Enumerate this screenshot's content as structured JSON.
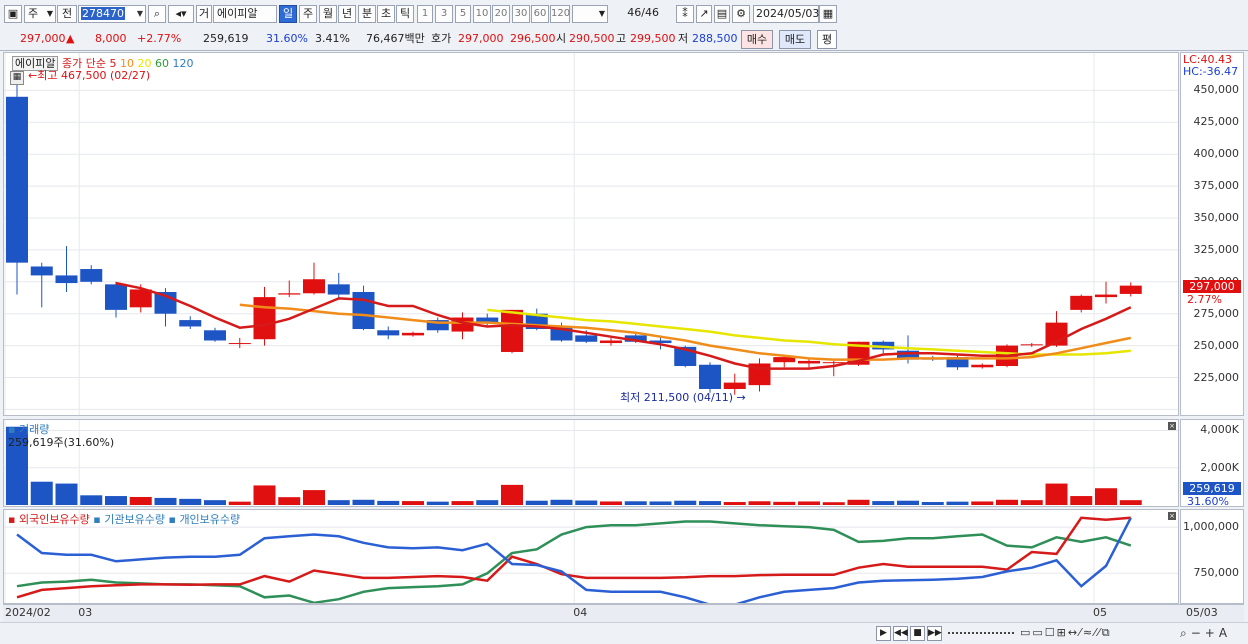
{
  "toolbar": {
    "market": "주",
    "period_ref": "전",
    "code": "278470",
    "trade_label": "거",
    "stock_name": "에이피알",
    "periods": [
      "일",
      "주",
      "월",
      "년",
      "분",
      "초",
      "틱"
    ],
    "selected_period": "일",
    "intervals": [
      "1",
      "3",
      "5",
      "10",
      "20",
      "30",
      "60",
      "120"
    ],
    "count": "46/46",
    "date": "2024/05/03"
  },
  "pricebar": {
    "price": "297,000",
    "direction": "▲",
    "change": "8,000",
    "change_pct": "+2.77%",
    "volume": "259,619",
    "turnover": "31.60%",
    "ratio": "3.41%",
    "amount": "76,467백만",
    "quote_label": "호가",
    "ask": "297,000",
    "bid": "296,500",
    "open_label": "시",
    "open": "290,500",
    "high_label": "고",
    "high": "299,500",
    "low_label": "저",
    "low": "288,500",
    "buy_label": "매수",
    "sell_label": "매도",
    "avg_label": "평"
  },
  "chart_legend": {
    "name": "에이피알",
    "ma_label": "종가 단순",
    "ma_periods": [
      "5",
      "10",
      "20",
      "60",
      "120"
    ],
    "ma_colors": [
      "#d61a1a",
      "#f08c1a",
      "#e6e600",
      "#2f9a3c",
      "#2e7dbd"
    ],
    "high_note": "최고 467,500 (02/27)",
    "low_note": "최저 211,500 (04/11)",
    "lc": "LC:40.43",
    "hc": "HC:-36.47",
    "current_price": "297,000",
    "current_pct": "2.77%"
  },
  "volume_legend": {
    "title": "거래량",
    "current": "259,619주(31.60%)",
    "axis_current": "259,619",
    "axis_pct": "31.60%"
  },
  "holdings_legend": {
    "foreign": "외국인보유수량",
    "institution": "기관보유수량",
    "individual": "개인보유수량"
  },
  "price_axis": [
    "450,000",
    "425,000",
    "400,000",
    "375,000",
    "350,000",
    "325,000",
    "300,000",
    "275,000",
    "250,000",
    "225,000"
  ],
  "volume_axis": [
    "4,000K",
    "2,000K"
  ],
  "holdings_axis": [
    "1,000,000",
    "750,000"
  ],
  "date_axis": [
    {
      "label": "2024/02",
      "idx": 0
    },
    {
      "label": "03",
      "idx": 3
    },
    {
      "label": "04",
      "idx": 23
    },
    {
      "label": "05",
      "idx": 44
    },
    {
      "label": "05/03",
      "idx": 48
    }
  ],
  "chart_data": {
    "type": "candlestick",
    "ylim": [
      200000,
      470000
    ],
    "candles": [
      {
        "o": 445000,
        "h": 467500,
        "l": 290000,
        "c": 315000
      },
      {
        "o": 312000,
        "h": 315000,
        "l": 280000,
        "c": 305000
      },
      {
        "o": 305000,
        "h": 328000,
        "l": 292000,
        "c": 299000
      },
      {
        "o": 310000,
        "h": 313000,
        "l": 298000,
        "c": 300000
      },
      {
        "o": 298000,
        "h": 300000,
        "l": 272000,
        "c": 278000
      },
      {
        "o": 280000,
        "h": 298000,
        "l": 276000,
        "c": 294000
      },
      {
        "o": 292000,
        "h": 295000,
        "l": 265000,
        "c": 275000
      },
      {
        "o": 270000,
        "h": 273000,
        "l": 263000,
        "c": 265000
      },
      {
        "o": 262000,
        "h": 264000,
        "l": 253000,
        "c": 254000
      },
      {
        "o": 252000,
        "h": 256000,
        "l": 248000,
        "c": 252000
      },
      {
        "o": 255000,
        "h": 296000,
        "l": 250000,
        "c": 288000
      },
      {
        "o": 290000,
        "h": 301000,
        "l": 288000,
        "c": 291000
      },
      {
        "o": 291000,
        "h": 315000,
        "l": 290000,
        "c": 302000
      },
      {
        "o": 298000,
        "h": 307000,
        "l": 286000,
        "c": 290000
      },
      {
        "o": 292000,
        "h": 297000,
        "l": 262000,
        "c": 263000
      },
      {
        "o": 262000,
        "h": 265000,
        "l": 255000,
        "c": 258000
      },
      {
        "o": 258000,
        "h": 261000,
        "l": 257000,
        "c": 260000
      },
      {
        "o": 270000,
        "h": 272000,
        "l": 260000,
        "c": 262000
      },
      {
        "o": 261000,
        "h": 276000,
        "l": 255000,
        "c": 272000
      },
      {
        "o": 272000,
        "h": 275000,
        "l": 266000,
        "c": 268000
      },
      {
        "o": 245000,
        "h": 278000,
        "l": 244000,
        "c": 278000
      },
      {
        "o": 275000,
        "h": 279000,
        "l": 262000,
        "c": 263000
      },
      {
        "o": 265000,
        "h": 268000,
        "l": 253000,
        "c": 254000
      },
      {
        "o": 258000,
        "h": 262000,
        "l": 252000,
        "c": 253000
      },
      {
        "o": 252000,
        "h": 256000,
        "l": 250000,
        "c": 254000
      },
      {
        "o": 258000,
        "h": 260000,
        "l": 252000,
        "c": 253000
      },
      {
        "o": 254000,
        "h": 258000,
        "l": 247000,
        "c": 252000
      },
      {
        "o": 249000,
        "h": 250000,
        "l": 233000,
        "c": 234000
      },
      {
        "o": 235000,
        "h": 237000,
        "l": 213000,
        "c": 216000
      },
      {
        "o": 216000,
        "h": 228000,
        "l": 211500,
        "c": 221000
      },
      {
        "o": 219000,
        "h": 240000,
        "l": 214000,
        "c": 236000
      },
      {
        "o": 237000,
        "h": 242000,
        "l": 233000,
        "c": 241000
      },
      {
        "o": 236000,
        "h": 240000,
        "l": 232000,
        "c": 238000
      },
      {
        "o": 237000,
        "h": 238000,
        "l": 226000,
        "c": 237000
      },
      {
        "o": 235000,
        "h": 253000,
        "l": 234000,
        "c": 253000
      },
      {
        "o": 253000,
        "h": 254000,
        "l": 244000,
        "c": 247000
      },
      {
        "o": 246000,
        "h": 258000,
        "l": 236000,
        "c": 239000
      },
      {
        "o": 240000,
        "h": 242000,
        "l": 238000,
        "c": 239000
      },
      {
        "o": 241000,
        "h": 243000,
        "l": 231000,
        "c": 233000
      },
      {
        "o": 233000,
        "h": 236000,
        "l": 232000,
        "c": 235000
      },
      {
        "o": 234000,
        "h": 251000,
        "l": 233000,
        "c": 250000
      },
      {
        "o": 251000,
        "h": 252000,
        "l": 249000,
        "c": 251000
      },
      {
        "o": 250000,
        "h": 277000,
        "l": 249000,
        "c": 268000
      },
      {
        "o": 278000,
        "h": 290000,
        "l": 276000,
        "c": 289000
      },
      {
        "o": 288000,
        "h": 300000,
        "l": 283000,
        "c": 290000
      },
      {
        "o": 290500,
        "h": 299500,
        "l": 288500,
        "c": 297000
      }
    ],
    "ma5": [
      null,
      null,
      null,
      null,
      299000,
      295000,
      289000,
      281000,
      272000,
      264000,
      266000,
      271000,
      279000,
      287000,
      286000,
      281000,
      281000,
      274000,
      268000,
      265000,
      266000,
      265000,
      263000,
      260000,
      257000,
      254000,
      251000,
      247000,
      242000,
      236000,
      232000,
      232000,
      232000,
      234000,
      238000,
      243000,
      244000,
      244000,
      243000,
      242000,
      242000,
      244000,
      253000,
      263000,
      271000,
      280000
    ],
    "ma10": [
      null,
      null,
      null,
      null,
      null,
      null,
      null,
      null,
      null,
      282000,
      280000,
      279000,
      277000,
      275000,
      274000,
      272000,
      270000,
      268000,
      268000,
      268000,
      267000,
      266000,
      265000,
      264000,
      262000,
      260000,
      257000,
      254000,
      250000,
      247000,
      244000,
      242000,
      240000,
      239000,
      239000,
      239000,
      240000,
      240000,
      240000,
      240000,
      240000,
      241000,
      244000,
      248000,
      252000,
      256000
    ],
    "ma20": [
      null,
      null,
      null,
      null,
      null,
      null,
      null,
      null,
      null,
      null,
      null,
      null,
      null,
      null,
      null,
      null,
      null,
      null,
      null,
      278000,
      276000,
      274000,
      272000,
      270000,
      269000,
      267000,
      265000,
      263000,
      261000,
      258000,
      256000,
      254000,
      253000,
      251000,
      250000,
      249000,
      248000,
      247000,
      246000,
      245000,
      244000,
      243000,
      243000,
      243000,
      244000,
      246000
    ],
    "volume": [
      4200000,
      1250000,
      1150000,
      520000,
      480000,
      430000,
      380000,
      330000,
      260000,
      180000,
      1050000,
      420000,
      800000,
      260000,
      280000,
      220000,
      210000,
      180000,
      210000,
      260000,
      1080000,
      230000,
      280000,
      240000,
      190000,
      200000,
      190000,
      230000,
      210000,
      160000,
      200000,
      170000,
      190000,
      150000,
      280000,
      210000,
      230000,
      160000,
      180000,
      190000,
      280000,
      260000,
      1150000,
      480000,
      900000,
      259619
    ],
    "vol_max": 4400000,
    "holdings_ylim": [
      600000,
      1060000
    ],
    "foreign": [
      620000,
      660000,
      670000,
      680000,
      685000,
      690000,
      690000,
      688000,
      690000,
      690000,
      735000,
      705000,
      765000,
      745000,
      725000,
      725000,
      730000,
      735000,
      730000,
      710000,
      840000,
      800000,
      745000,
      725000,
      725000,
      725000,
      725000,
      728000,
      735000,
      735000,
      740000,
      742000,
      742000,
      742000,
      780000,
      800000,
      785000,
      785000,
      785000,
      785000,
      770000,
      865000,
      855000,
      1050000,
      1040000,
      1050000
    ],
    "institution": [
      680000,
      700000,
      705000,
      715000,
      700000,
      695000,
      690000,
      690000,
      685000,
      680000,
      620000,
      630000,
      590000,
      610000,
      650000,
      670000,
      675000,
      680000,
      690000,
      750000,
      860000,
      880000,
      960000,
      1000000,
      1010000,
      1010000,
      1020000,
      1030000,
      1030000,
      1020000,
      1010000,
      1005000,
      1000000,
      985000,
      920000,
      925000,
      940000,
      940000,
      950000,
      960000,
      900000,
      890000,
      945000,
      920000,
      945000,
      900000
    ],
    "individual": [
      960000,
      860000,
      850000,
      850000,
      815000,
      825000,
      835000,
      840000,
      840000,
      850000,
      940000,
      950000,
      960000,
      950000,
      915000,
      890000,
      885000,
      890000,
      875000,
      910000,
      800000,
      795000,
      760000,
      660000,
      650000,
      650000,
      650000,
      620000,
      580000,
      580000,
      620000,
      650000,
      660000,
      670000,
      700000,
      710000,
      712000,
      715000,
      720000,
      730000,
      760000,
      780000,
      820000,
      680000,
      790000,
      1050000
    ]
  }
}
